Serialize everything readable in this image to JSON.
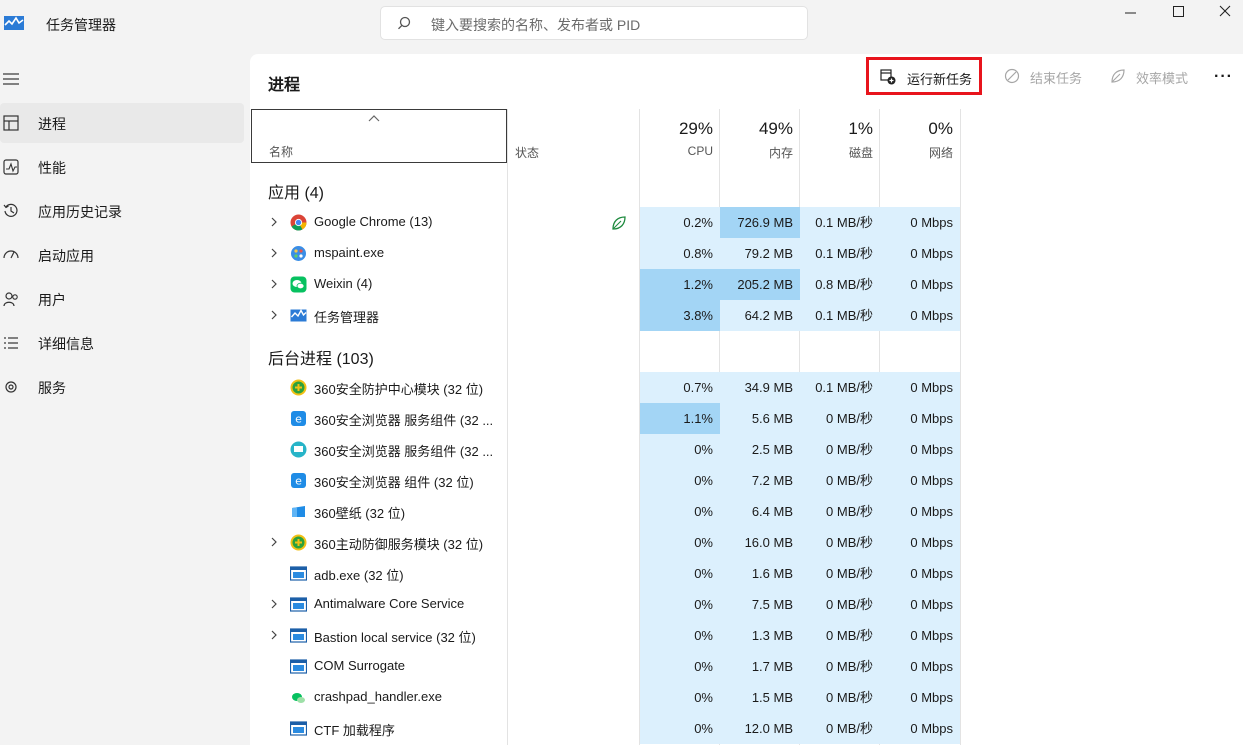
{
  "app": {
    "title": "任务管理器"
  },
  "search": {
    "placeholder": "键入要搜索的名称、发布者或 PID"
  },
  "window_controls": {
    "minimize": "—",
    "maximize": "☐",
    "close": "✕"
  },
  "sidebar": {
    "items": [
      {
        "label": "进程",
        "icon": "processes-icon",
        "active": true
      },
      {
        "label": "性能",
        "icon": "performance-icon"
      },
      {
        "label": "应用历史记录",
        "icon": "app-history-icon"
      },
      {
        "label": "启动应用",
        "icon": "startup-apps-icon"
      },
      {
        "label": "用户",
        "icon": "users-icon"
      },
      {
        "label": "详细信息",
        "icon": "details-icon"
      },
      {
        "label": "服务",
        "icon": "services-icon"
      }
    ]
  },
  "toolbar": {
    "title": "进程",
    "run_new_task": "运行新任务",
    "end_task": "结束任务",
    "efficiency_mode": "效率模式",
    "more": "···"
  },
  "columns": {
    "name": "名称",
    "status": "状态",
    "cpu": {
      "pct": "29%",
      "label": "CPU"
    },
    "memory": {
      "pct": "49%",
      "label": "内存"
    },
    "disk": {
      "pct": "1%",
      "label": "磁盘"
    },
    "network": {
      "pct": "0%",
      "label": "网络"
    }
  },
  "groups": {
    "apps": "应用 (4)",
    "background": "后台进程 (103)"
  },
  "apps": [
    {
      "name": "Google Chrome (13)",
      "icon": "chrome-icon",
      "expandable": true,
      "status_icon": "efficiency-leaf-icon",
      "cpu": "0.2%",
      "mem": "726.9 MB",
      "disk": "0.1 MB/秒",
      "net": "0 Mbps"
    },
    {
      "name": "mspaint.exe",
      "icon": "paint-icon",
      "expandable": true,
      "cpu": "0.8%",
      "mem": "79.2 MB",
      "disk": "0.1 MB/秒",
      "net": "0 Mbps"
    },
    {
      "name": "Weixin (4)",
      "icon": "wechat-icon",
      "expandable": true,
      "cpu": "1.2%",
      "mem": "205.2 MB",
      "disk": "0.8 MB/秒",
      "net": "0 Mbps"
    },
    {
      "name": "任务管理器",
      "icon": "task-manager-icon",
      "expandable": true,
      "cpu": "3.8%",
      "mem": "64.2 MB",
      "disk": "0.1 MB/秒",
      "net": "0 Mbps"
    }
  ],
  "background": [
    {
      "name": "360安全防护中心模块 (32 位)",
      "icon": "360-shield-icon",
      "expandable": false,
      "cpu": "0.7%",
      "mem": "34.9 MB",
      "disk": "0.1 MB/秒",
      "net": "0 Mbps"
    },
    {
      "name": "360安全浏览器 服务组件 (32 ...",
      "icon": "360-browser-icon",
      "expandable": false,
      "cpu": "1.1%",
      "mem": "5.6 MB",
      "disk": "0 MB/秒",
      "net": "0 Mbps"
    },
    {
      "name": "360安全浏览器 服务组件 (32 ...",
      "icon": "360-service-icon",
      "expandable": false,
      "cpu": "0%",
      "mem": "2.5 MB",
      "disk": "0 MB/秒",
      "net": "0 Mbps"
    },
    {
      "name": "360安全浏览器 组件 (32 位)",
      "icon": "360-browser-icon",
      "expandable": false,
      "cpu": "0%",
      "mem": "7.2 MB",
      "disk": "0 MB/秒",
      "net": "0 Mbps"
    },
    {
      "name": "360壁纸 (32 位)",
      "icon": "wallpaper-icon",
      "expandable": false,
      "cpu": "0%",
      "mem": "6.4 MB",
      "disk": "0 MB/秒",
      "net": "0 Mbps"
    },
    {
      "name": "360主动防御服务模块 (32 位)",
      "icon": "360-shield-icon",
      "expandable": true,
      "cpu": "0%",
      "mem": "16.0 MB",
      "disk": "0 MB/秒",
      "net": "0 Mbps"
    },
    {
      "name": "adb.exe (32 位)",
      "icon": "window-app-icon",
      "expandable": false,
      "cpu": "0%",
      "mem": "1.6 MB",
      "disk": "0 MB/秒",
      "net": "0 Mbps"
    },
    {
      "name": "Antimalware Core Service",
      "icon": "window-app-icon",
      "expandable": true,
      "cpu": "0%",
      "mem": "7.5 MB",
      "disk": "0 MB/秒",
      "net": "0 Mbps"
    },
    {
      "name": "Bastion local service (32 位)",
      "icon": "window-app-icon",
      "expandable": true,
      "cpu": "0%",
      "mem": "1.3 MB",
      "disk": "0 MB/秒",
      "net": "0 Mbps"
    },
    {
      "name": "COM Surrogate",
      "icon": "window-app-icon",
      "expandable": false,
      "cpu": "0%",
      "mem": "1.7 MB",
      "disk": "0 MB/秒",
      "net": "0 Mbps"
    },
    {
      "name": "crashpad_handler.exe",
      "icon": "wechat-small-icon",
      "expandable": false,
      "cpu": "0%",
      "mem": "1.5 MB",
      "disk": "0 MB/秒",
      "net": "0 Mbps"
    },
    {
      "name": "CTF 加载程序",
      "icon": "window-app-icon",
      "expandable": false,
      "cpu": "0%",
      "mem": "12.0 MB",
      "disk": "0 MB/秒",
      "net": "0 Mbps"
    }
  ],
  "colors": {
    "heat_low": "#dcf0fd",
    "heat_high": "#a3d5f5",
    "highlight_border": "#e8141c"
  }
}
